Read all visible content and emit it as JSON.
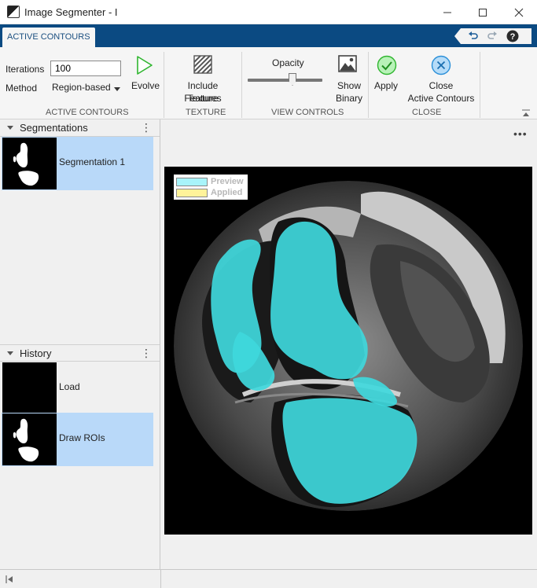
{
  "window": {
    "title": "Image Segmenter - I"
  },
  "tabs": {
    "active_label": "ACTIVE CONTOURS"
  },
  "toolstrip": {
    "active_contours": {
      "iterations_label": "Iterations",
      "iterations_value": "100",
      "method_label": "Method",
      "method_value": "Region-based",
      "evolve_label": "Evolve",
      "section_label": "ACTIVE CONTOURS"
    },
    "texture": {
      "include_label_line1": "Include Texture",
      "include_label_line2": "Features",
      "section_label": "TEXTURE"
    },
    "view_controls": {
      "opacity_label": "Opacity",
      "opacity_value": 0.6,
      "show_binary_line1": "Show",
      "show_binary_line2": "Binary",
      "section_label": "VIEW CONTROLS"
    },
    "close": {
      "apply_label": "Apply",
      "close_line1": "Close",
      "close_line2": "Active Contours",
      "section_label": "CLOSE"
    }
  },
  "segmentations_panel": {
    "title": "Segmentations",
    "items": [
      {
        "label": "Segmentation 1"
      }
    ]
  },
  "history_panel": {
    "title": "History",
    "items": [
      {
        "label": "Load"
      },
      {
        "label": "Draw ROIs"
      }
    ]
  },
  "legend": {
    "preview_label": "Preview",
    "applied_label": "Applied",
    "preview_color": "#a8f4fa",
    "applied_color": "#fff39a"
  },
  "colors": {
    "tab_bar": "#0b4a82",
    "selection": "#b9d9f9",
    "overlay": "#3fd8dc",
    "evolve_green": "#2fb52f",
    "close_blue": "#2a8fd8"
  },
  "icons": {
    "app": "app-icon",
    "undo": "undo-icon",
    "redo": "redo-icon",
    "help": "help-icon",
    "evolve": "play-icon",
    "texture": "texture-icon",
    "show_binary": "image-icon",
    "apply": "checkmark-icon",
    "close": "close-circle-icon"
  }
}
